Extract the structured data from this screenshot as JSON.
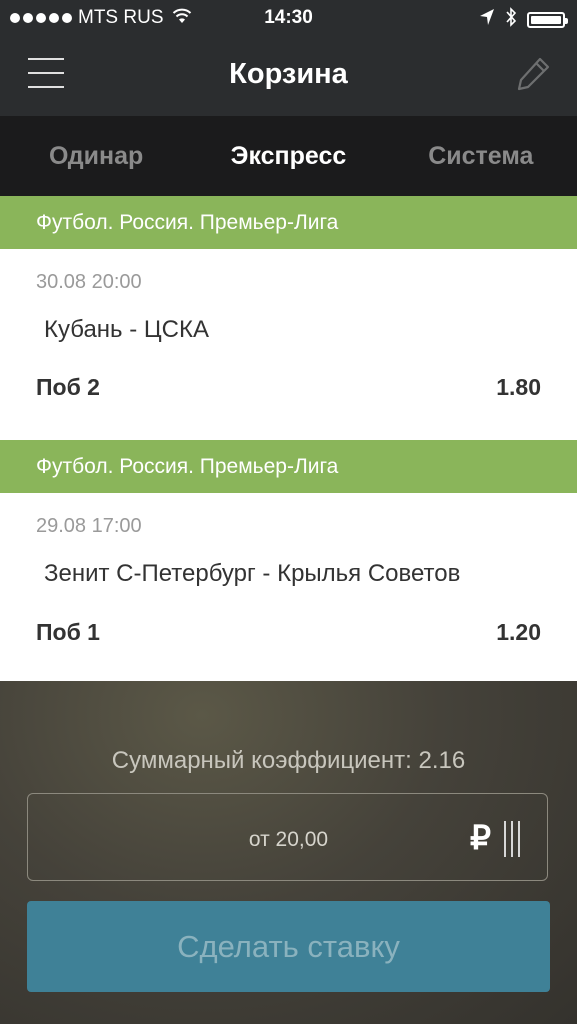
{
  "status_bar": {
    "carrier": "MTS RUS",
    "time": "14:30"
  },
  "header": {
    "title": "Корзина"
  },
  "tabs": [
    {
      "label": "Одинар",
      "active": false
    },
    {
      "label": "Экспресс",
      "active": true
    },
    {
      "label": "Система",
      "active": false
    }
  ],
  "bets": [
    {
      "league": "Футбол. Россия. Премьер-Лига",
      "date": "30.08 20:00",
      "teams": "Кубань - ЦСКА",
      "outcome": "Поб 2",
      "odds": "1.80"
    },
    {
      "league": "Футбол. Россия. Премьер-Лига",
      "date": "29.08 17:00",
      "teams": "Зенит С-Петербург - Крылья Советов",
      "outcome": "Поб 1",
      "odds": "1.20"
    }
  ],
  "summary": {
    "total_label": "Суммарный коэффициент: 2.16",
    "stake_placeholder": "от 20,00",
    "currency_symbol": "₽",
    "submit_label": "Сделать ставку"
  },
  "colors": {
    "league_bar": "#8ab55a",
    "submit_button": "#3f8197",
    "header_bg": "#2b2d2f",
    "tabs_bg": "#1b1b1c"
  },
  "icons": [
    "menu-icon",
    "edit-icon",
    "wifi-icon",
    "location-icon",
    "bluetooth-icon",
    "battery-icon",
    "keyboard-toggle-icon"
  ]
}
